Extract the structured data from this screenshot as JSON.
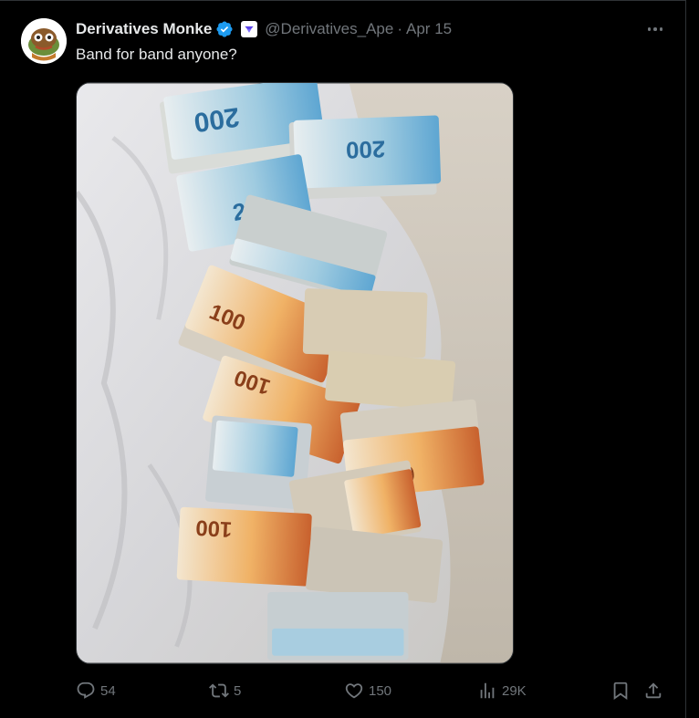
{
  "post": {
    "author_name": "Derivatives Monke",
    "author_handle": "@Derivatives_Ape",
    "separator": "·",
    "date": "Apr 15",
    "text": "Band for band anyone?"
  },
  "media": {
    "banknote_labels": [
      "200",
      "100"
    ]
  },
  "actions": {
    "replies": "54",
    "reposts": "5",
    "likes": "150",
    "views": "29K"
  },
  "colors": {
    "background": "#000000",
    "text_primary": "#e7e9ea",
    "text_secondary": "#71767b",
    "verified_blue": "#1d9bf0",
    "border": "#2f3336"
  },
  "icons": [
    "verified-badge-icon",
    "affiliate-badge-icon",
    "more-icon",
    "reply-icon",
    "repost-icon",
    "like-icon",
    "views-icon",
    "bookmark-icon",
    "share-icon"
  ]
}
